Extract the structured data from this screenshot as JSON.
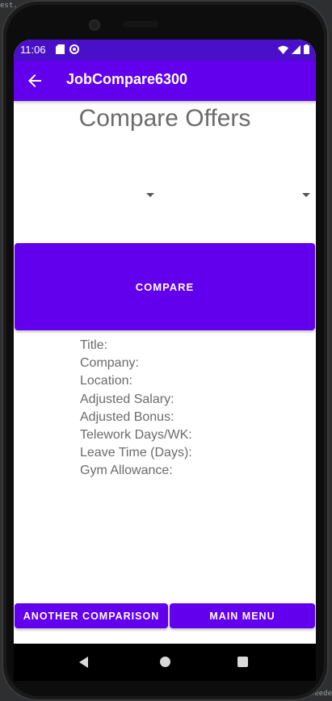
{
  "status_bar": {
    "time": "11:06"
  },
  "app_bar": {
    "title": "JobCompare6300"
  },
  "page": {
    "title": "Compare Offers"
  },
  "compare_button": {
    "label": "COMPARE"
  },
  "details": {
    "labels": [
      "Title:",
      "Company:",
      "Location:",
      "Adjusted Salary:",
      "Adjusted Bonus:",
      "Telework Days/WK:",
      "Leave Time (Days):",
      "Gym Allowance:"
    ]
  },
  "footer": {
    "another_label": "ANOTHER COMPARISON",
    "main_menu_label": "MAIN MENU"
  },
  "background_ide": {
    "text_top": "est.",
    "text_bottom": "ceede"
  },
  "colors": {
    "primary": "#6200ee",
    "status_bar": "#4a0fc8",
    "text_gray": "#6b6b6b"
  }
}
